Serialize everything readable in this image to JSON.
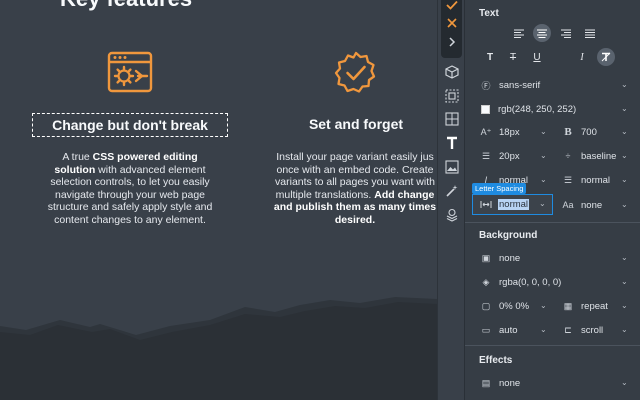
{
  "canvas": {
    "heading_partial": "Key features",
    "features": [
      {
        "title": "Change but don't break",
        "desc_lines": [
          [
            "A true ",
            "b:CSS powered editing"
          ],
          [
            "b:solution",
            " with advanced element"
          ],
          [
            "selection controls, to let you easily"
          ],
          [
            "navigate through your web page"
          ],
          [
            "structure and safely apply style and"
          ],
          [
            "content changes to any element."
          ]
        ]
      },
      {
        "title": "Set and forget",
        "desc_lines": [
          [
            "Install your page variant easily jus"
          ],
          [
            "once with an embed code. Create"
          ],
          [
            "variants to all pages you want with"
          ],
          [
            "multiple translations. ",
            "b:Add change"
          ],
          [
            "b:and publish them as many times"
          ],
          [
            "b:desired."
          ]
        ]
      }
    ]
  },
  "panel": {
    "text_section": {
      "title": "Text",
      "font_family": "sans-serif",
      "color": "rgb(248, 250, 252)",
      "font_size": "18px",
      "font_weight": "700",
      "line_height": "20px",
      "vertical_align": "baseline",
      "font_style": "normal",
      "text_transform": "normal",
      "letter_spacing_tooltip": "Letter Spacing",
      "letter_spacing": "normal",
      "aa_label": "Aa",
      "text_case": "none"
    },
    "background_section": {
      "title": "Background",
      "image": "none",
      "color": "rgba(0, 0, 0, 0)",
      "position": "0% 0%",
      "repeat": "repeat",
      "size": "auto",
      "attachment": "scroll"
    },
    "effects_section": {
      "title": "Effects",
      "value": "none"
    }
  },
  "colors": {
    "accent_orange": "#f0973d",
    "selection_blue": "#1f8be0",
    "canvas_bg": "#394049",
    "mountain_dark": "#2b3036"
  }
}
